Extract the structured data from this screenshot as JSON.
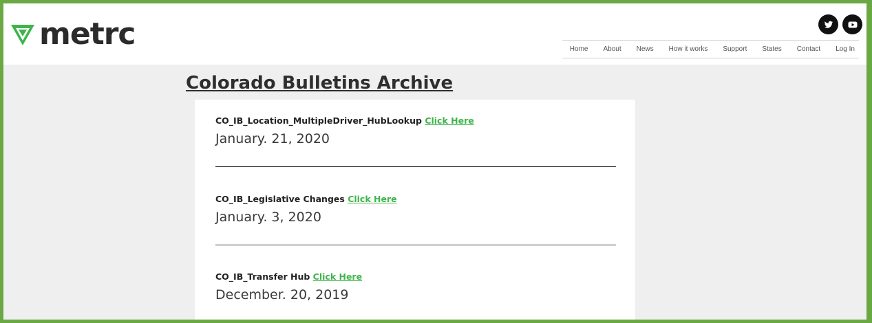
{
  "brand": {
    "name": "metrc",
    "accent": "#6aa843",
    "link_color": "#3fb44b"
  },
  "social": [
    {
      "icon": "twitter-icon"
    },
    {
      "icon": "youtube-icon"
    }
  ],
  "nav": {
    "items": [
      "Home",
      "About",
      "News",
      "How it works",
      "Support",
      "States",
      "Contact",
      "Log In"
    ]
  },
  "page": {
    "title": "Colorado Bulletins Archive"
  },
  "bulletins": [
    {
      "title": "CO_IB_Location_MultipleDriver_HubLookup",
      "link": "Click Here",
      "date": "January. 21, 2020"
    },
    {
      "title": "CO_IB_Legislative Changes",
      "link": "Click Here",
      "date": "January. 3, 2020"
    },
    {
      "title": "CO_IB_Transfer Hub",
      "link": "Click Here",
      "date": "December. 20, 2019"
    }
  ]
}
